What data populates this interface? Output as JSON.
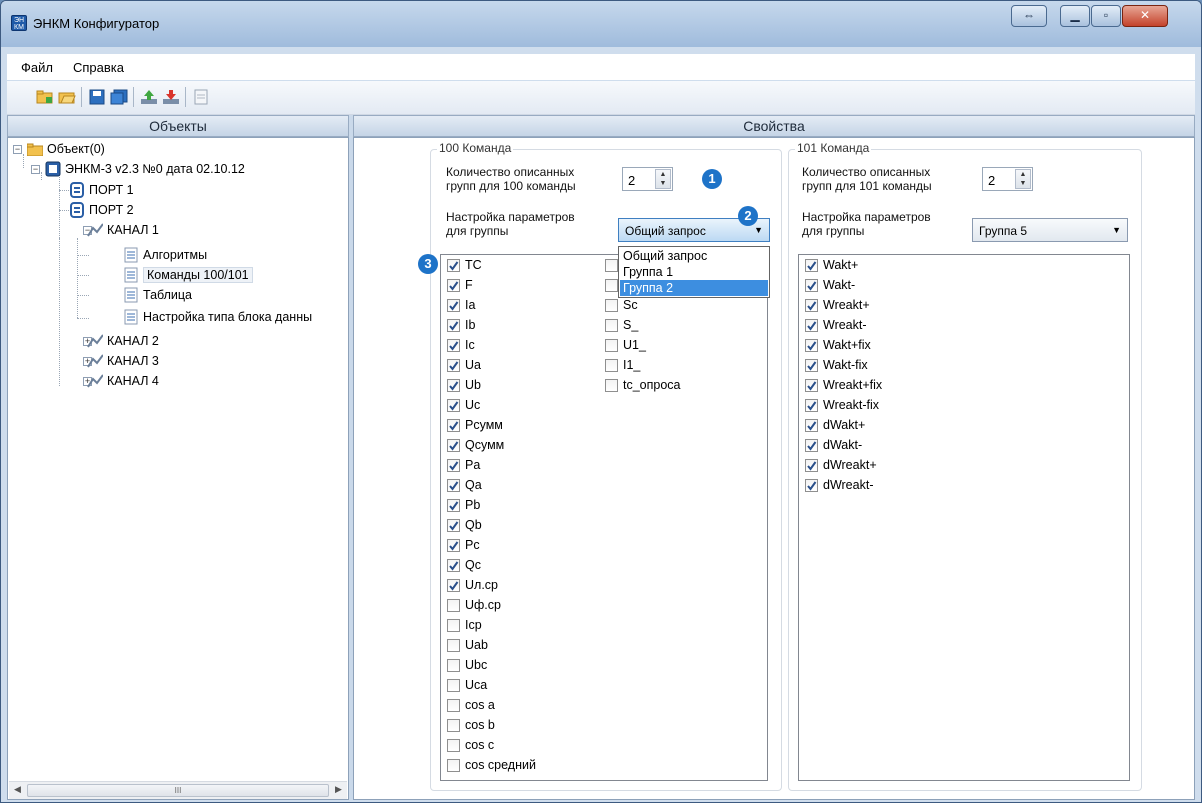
{
  "window": {
    "title": "ЭНКМ Конфигуратор",
    "icon_text": "ЭН КМ"
  },
  "menu": [
    {
      "label": "Файл"
    },
    {
      "label": "Справка"
    }
  ],
  "panels": {
    "objects_header": "Объекты",
    "properties_header": "Свойства"
  },
  "tree": {
    "root": "Объект(0)",
    "device": "ЭНКМ-3 v2.3 №0 дата 02.10.12",
    "port1": "ПОРТ 1",
    "port2": "ПОРТ 2",
    "channel1": "КАНАЛ 1",
    "algorithms": "Алгоритмы",
    "commands": "Команды 100/101",
    "table": "Таблица",
    "blocktype": "Настройка типа блока данны",
    "channel2": "КАНАЛ 2",
    "channel3": "КАНАЛ 3",
    "channel4": "КАНАЛ 4",
    "scroll_grip": "III"
  },
  "cmd100": {
    "legend": "100 Команда",
    "count_label_line1": "Количество описанных",
    "count_label_line2": "групп для 100 команды",
    "count_value": "2",
    "group_label_line1": "Настройка параметров",
    "group_label_line2": "для группы",
    "group_selected": "Общий запрос",
    "dropdown": [
      "Общий запрос",
      "Группа 1",
      "Группа 2"
    ],
    "col1": [
      {
        "label": "TC",
        "checked": true
      },
      {
        "label": "F",
        "checked": true
      },
      {
        "label": "Ia",
        "checked": true
      },
      {
        "label": "Ib",
        "checked": true
      },
      {
        "label": "Ic",
        "checked": true
      },
      {
        "label": "Ua",
        "checked": true
      },
      {
        "label": "Ub",
        "checked": true
      },
      {
        "label": "Uc",
        "checked": true
      },
      {
        "label": "Pсумм",
        "checked": true
      },
      {
        "label": "Qсумм",
        "checked": true
      },
      {
        "label": "Pa",
        "checked": true
      },
      {
        "label": "Qa",
        "checked": true
      },
      {
        "label": "Pb",
        "checked": true
      },
      {
        "label": "Qb",
        "checked": true
      },
      {
        "label": "Pc",
        "checked": true
      },
      {
        "label": "Qc",
        "checked": true
      },
      {
        "label": "Uл.ср",
        "checked": true
      },
      {
        "label": "Uф.ср",
        "checked": false
      },
      {
        "label": "Icp",
        "checked": false
      },
      {
        "label": "Uab",
        "checked": false
      },
      {
        "label": "Ubc",
        "checked": false
      },
      {
        "label": "Uca",
        "checked": false
      },
      {
        "label": "cos a",
        "checked": false
      },
      {
        "label": "cos b",
        "checked": false
      },
      {
        "label": "cos c",
        "checked": false
      },
      {
        "label": "cos средний",
        "checked": false
      }
    ],
    "col2": [
      {
        "label": "",
        "checked": false
      },
      {
        "label": "",
        "checked": false
      },
      {
        "label": "Sc",
        "checked": false
      },
      {
        "label": "S_",
        "checked": false
      },
      {
        "label": "U1_",
        "checked": false
      },
      {
        "label": "I1_",
        "checked": false
      },
      {
        "label": "tc_опроса",
        "checked": false
      }
    ]
  },
  "cmd101": {
    "legend": "101 Команда",
    "count_label_line1": "Количество описанных",
    "count_label_line2": "групп для 101 команды",
    "count_value": "2",
    "group_label_line1": "Настройка параметров",
    "group_label_line2": "для группы",
    "group_selected": "Группа 5",
    "items": [
      {
        "label": "Wakt+",
        "checked": true
      },
      {
        "label": "Wakt-",
        "checked": true
      },
      {
        "label": "Wreakt+",
        "checked": true
      },
      {
        "label": "Wreakt-",
        "checked": true
      },
      {
        "label": "Wakt+fix",
        "checked": true
      },
      {
        "label": "Wakt-fix",
        "checked": true
      },
      {
        "label": "Wreakt+fix",
        "checked": true
      },
      {
        "label": "Wreakt-fix",
        "checked": true
      },
      {
        "label": "dWakt+",
        "checked": true
      },
      {
        "label": "dWakt-",
        "checked": true
      },
      {
        "label": "dWreakt+",
        "checked": true
      },
      {
        "label": "dWreakt-",
        "checked": true
      }
    ]
  },
  "badges": [
    "1",
    "2",
    "3"
  ],
  "colors": {
    "accent": "#1e73c8",
    "selection": "#3d8ee0",
    "titlebar": "#9fbbdc"
  }
}
